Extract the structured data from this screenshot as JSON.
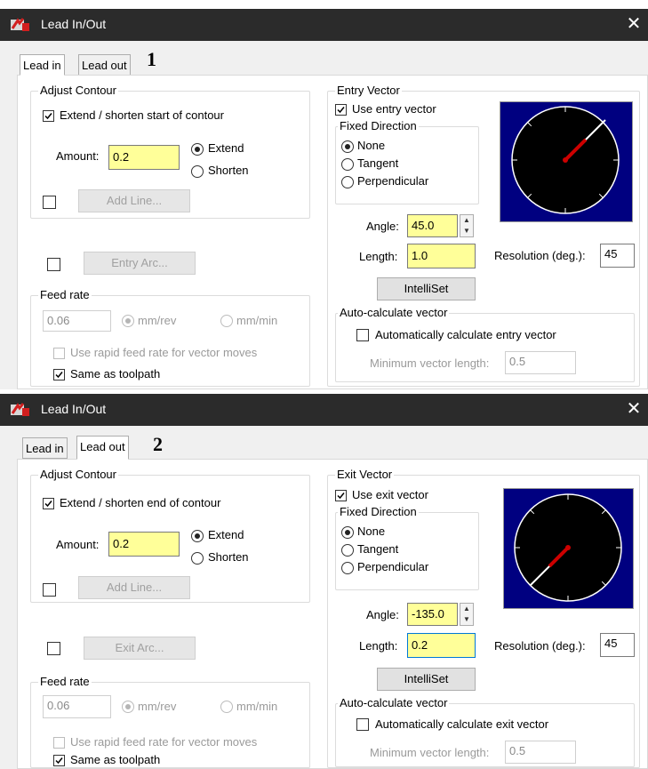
{
  "dialog1": {
    "title": "Lead In/Out",
    "close_glyph": "✕",
    "tabs": [
      "Lead in",
      "Lead out"
    ],
    "number": "1",
    "adjust_contour": {
      "label": "Adjust Contour",
      "extend_checkbox": "Extend / shorten start of contour",
      "amount_label": "Amount:",
      "amount_value": "0.2",
      "extend": "Extend",
      "shorten": "Shorten",
      "add_line": "Add Line..."
    },
    "entry_arc": "Entry Arc...",
    "feed_rate": {
      "label": "Feed rate",
      "value": "0.06",
      "mm_rev": "mm/rev",
      "mm_min": "mm/min",
      "rapid": "Use rapid feed rate for vector moves",
      "same": "Same as toolpath"
    },
    "vector": {
      "label": "Entry Vector",
      "use": "Use entry vector",
      "fixed_direction": "Fixed Direction",
      "none": "None",
      "tangent": "Tangent",
      "perpendicular": "Perpendicular",
      "angle_label": "Angle:",
      "angle_value": "45.0",
      "length_label": "Length:",
      "length_value": "1.0",
      "resolution_label": "Resolution (deg.):",
      "resolution_value": "45",
      "intelliset": "IntelliSet",
      "auto_label": "Auto-calculate vector",
      "auto_checkbox": "Automatically calculate entry vector",
      "min_label": "Minimum vector length:",
      "min_value": "0.5"
    }
  },
  "dialog2": {
    "title": "Lead In/Out",
    "close_glyph": "✕",
    "tabs": [
      "Lead in",
      "Lead out"
    ],
    "number": "2",
    "adjust_contour": {
      "label": "Adjust Contour",
      "extend_checkbox": "Extend / shorten end of contour",
      "amount_label": "Amount:",
      "amount_value": "0.2",
      "extend": "Extend",
      "shorten": "Shorten",
      "add_line": "Add Line..."
    },
    "exit_arc": "Exit Arc...",
    "feed_rate": {
      "label": "Feed rate",
      "value": "0.06",
      "mm_rev": "mm/rev",
      "mm_min": "mm/min",
      "rapid": "Use rapid feed rate for vector moves",
      "same": "Same as toolpath"
    },
    "vector": {
      "label": "Exit Vector",
      "use": "Use exit vector",
      "fixed_direction": "Fixed Direction",
      "none": "None",
      "tangent": "Tangent",
      "perpendicular": "Perpendicular",
      "angle_label": "Angle:",
      "angle_value": "-135.0",
      "length_label": "Length:",
      "length_value": "0.2",
      "resolution_label": "Resolution (deg.):",
      "resolution_value": "45",
      "intelliset": "IntelliSet",
      "auto_label": "Auto-calculate vector",
      "auto_checkbox": "Automatically calculate exit vector",
      "min_label": "Minimum vector length:",
      "min_value": "0.5"
    }
  },
  "colors": {
    "titlebar": "#2b2b2b",
    "highlight_field": "#ffff99",
    "compass_bg": "#000080",
    "needle": "#cc0000"
  }
}
